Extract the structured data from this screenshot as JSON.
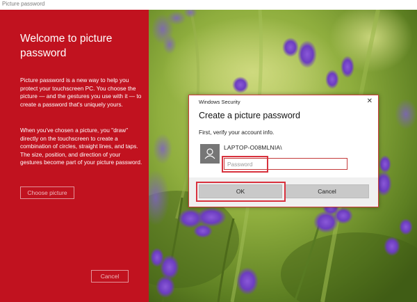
{
  "window": {
    "title": "Picture password"
  },
  "left_panel": {
    "heading": "Welcome to picture password",
    "paragraph1": "Picture password is a new way to help you protect your touchscreen PC. You choose the picture — and the gestures you use with it — to create a password that's uniquely yours.",
    "paragraph2": "When you've chosen a picture, you \"draw\" directly on the touchscreen to create a combination of circles, straight lines, and taps. The size, position, and direction of your gestures become part of your picture password.",
    "choose_label": "Choose picture",
    "cancel_label": "Cancel"
  },
  "dialog": {
    "caption": "Windows Security",
    "close_glyph": "✕",
    "title": "Create a picture password",
    "subtitle": "First, verify your account info.",
    "username": "LAPTOP-O08MLNIA\\",
    "password_placeholder": "Password",
    "password_value": "",
    "ok_label": "OK",
    "cancel_label": "Cancel"
  },
  "colors": {
    "accent_red": "#c1121f",
    "highlight_red": "#d8313d",
    "button_gray": "#c9c9c9"
  }
}
